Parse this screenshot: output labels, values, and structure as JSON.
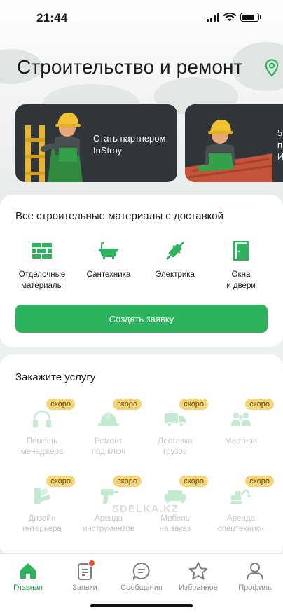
{
  "status": {
    "time": "21:44"
  },
  "header": {
    "title": "Строительство и ремонт"
  },
  "banners": [
    {
      "text": "Стать партнером\nInStroy"
    },
    {
      "text": "5\nп\nИ"
    }
  ],
  "materials": {
    "title": "Все строительные материалы с доставкой",
    "categories": [
      {
        "label": "Отделочные\nматериалы",
        "icon": "brick-wall-icon"
      },
      {
        "label": "Сантехника",
        "icon": "bathtub-icon"
      },
      {
        "label": "Электрика",
        "icon": "plug-icon"
      },
      {
        "label": "Окна\nи двери",
        "icon": "door-icon"
      }
    ],
    "cta": "Создать заявку"
  },
  "services": {
    "title": "Закажите услугу",
    "badge": "скоро",
    "items": [
      {
        "label": "Помощь\nменеджера",
        "icon": "headphones-icon"
      },
      {
        "label": "Ремонт\nпод ключ",
        "icon": "helmet-icon"
      },
      {
        "label": "Доставка\nгрузов",
        "icon": "truck-icon"
      },
      {
        "label": "Мастера",
        "icon": "workers-icon"
      },
      {
        "label": "Дизайн\nинтерьера",
        "icon": "palette-icon"
      },
      {
        "label": "Аренда\nинструментов",
        "icon": "drill-icon"
      },
      {
        "label": "Мебель\nна заказ",
        "icon": "sofa-icon"
      },
      {
        "label": "Аренда\nспецтехники",
        "icon": "excavator-icon"
      }
    ]
  },
  "watermark": "SDELKA.KZ",
  "tabs": [
    {
      "label": "Главная",
      "icon": "home-icon",
      "active": true
    },
    {
      "label": "Заявки",
      "icon": "clipboard-icon",
      "active": false
    },
    {
      "label": "Сообщения",
      "icon": "chat-icon",
      "active": false
    },
    {
      "label": "Избранное",
      "icon": "star-icon",
      "active": false
    },
    {
      "label": "Профиль",
      "icon": "profile-icon",
      "active": false
    }
  ],
  "colors": {
    "accent": "#2db35d",
    "badge": "#f6d57a",
    "banner": "#2f3538",
    "notification": "#ec4b2f"
  }
}
